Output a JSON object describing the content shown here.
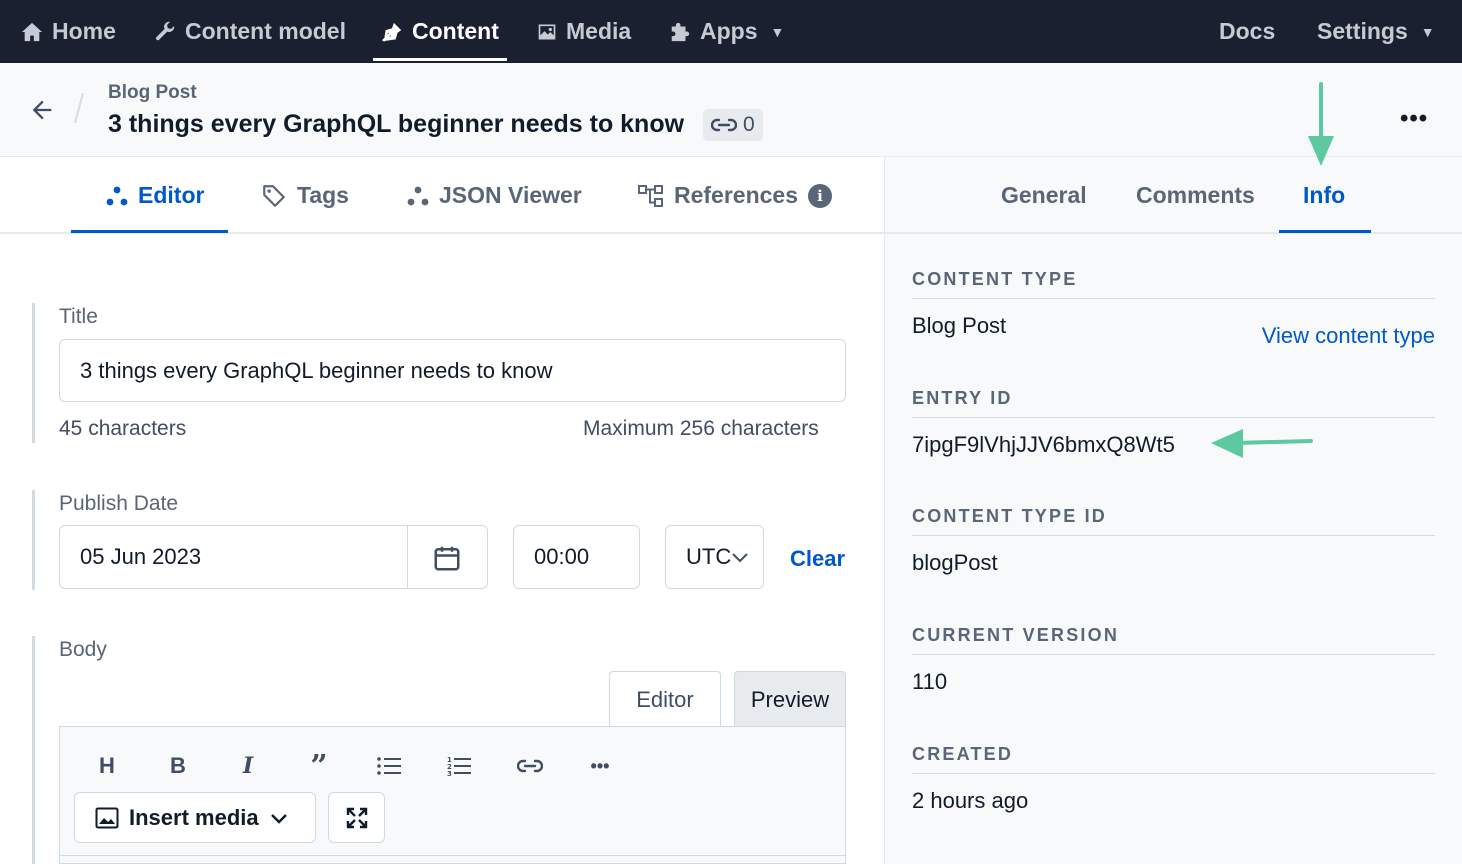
{
  "nav": {
    "items": [
      {
        "label": "Home",
        "icon": "home-icon"
      },
      {
        "label": "Content model",
        "icon": "wrench-icon"
      },
      {
        "label": "Content",
        "icon": "pen-nib-icon",
        "active": true
      },
      {
        "label": "Media",
        "icon": "image-icon"
      },
      {
        "label": "Apps",
        "icon": "puzzle-icon",
        "dropdown": true
      }
    ],
    "right": [
      {
        "label": "Docs"
      },
      {
        "label": "Settings",
        "dropdown": true
      }
    ]
  },
  "entry": {
    "content_type": "Blog Post",
    "title": "3 things every GraphQL beginner needs to know",
    "reference_count": "0"
  },
  "editor_tabs": [
    {
      "label": "Editor",
      "active": true
    },
    {
      "label": "Tags"
    },
    {
      "label": "JSON Viewer"
    },
    {
      "label": "References"
    }
  ],
  "sidebar_tabs": [
    {
      "label": "General"
    },
    {
      "label": "Comments"
    },
    {
      "label": "Info",
      "active": true
    }
  ],
  "fields": {
    "title": {
      "label": "Title",
      "value": "3 things every GraphQL beginner needs to know",
      "char_count": "45 characters",
      "max": "Maximum 256 characters"
    },
    "publish_date": {
      "label": "Publish Date",
      "date": "05 Jun 2023",
      "time": "00:00",
      "timezone": "UTC",
      "clear": "Clear"
    },
    "body": {
      "label": "Body",
      "mode_editor": "Editor",
      "mode_preview": "Preview",
      "toolbar": [
        "H",
        "B",
        "I",
        "quote",
        "bulleted-list",
        "numbered-list",
        "link",
        "more"
      ],
      "insert_media": "Insert media"
    }
  },
  "info": {
    "content_type": {
      "heading": "CONTENT TYPE",
      "value": "Blog Post",
      "link": "View content type"
    },
    "entry_id": {
      "heading": "ENTRY ID",
      "value": "7ipgF9lVhjJJV6bmxQ8Wt5"
    },
    "content_type_id": {
      "heading": "CONTENT TYPE ID",
      "value": "blogPost"
    },
    "current_version": {
      "heading": "CURRENT VERSION",
      "value": "110"
    },
    "created": {
      "heading": "CREATED",
      "value": "2 hours ago"
    }
  },
  "colors": {
    "nav_bg": "#1b2030",
    "accent": "#0059c8",
    "annotation_arrow": "#5cc9a0"
  }
}
